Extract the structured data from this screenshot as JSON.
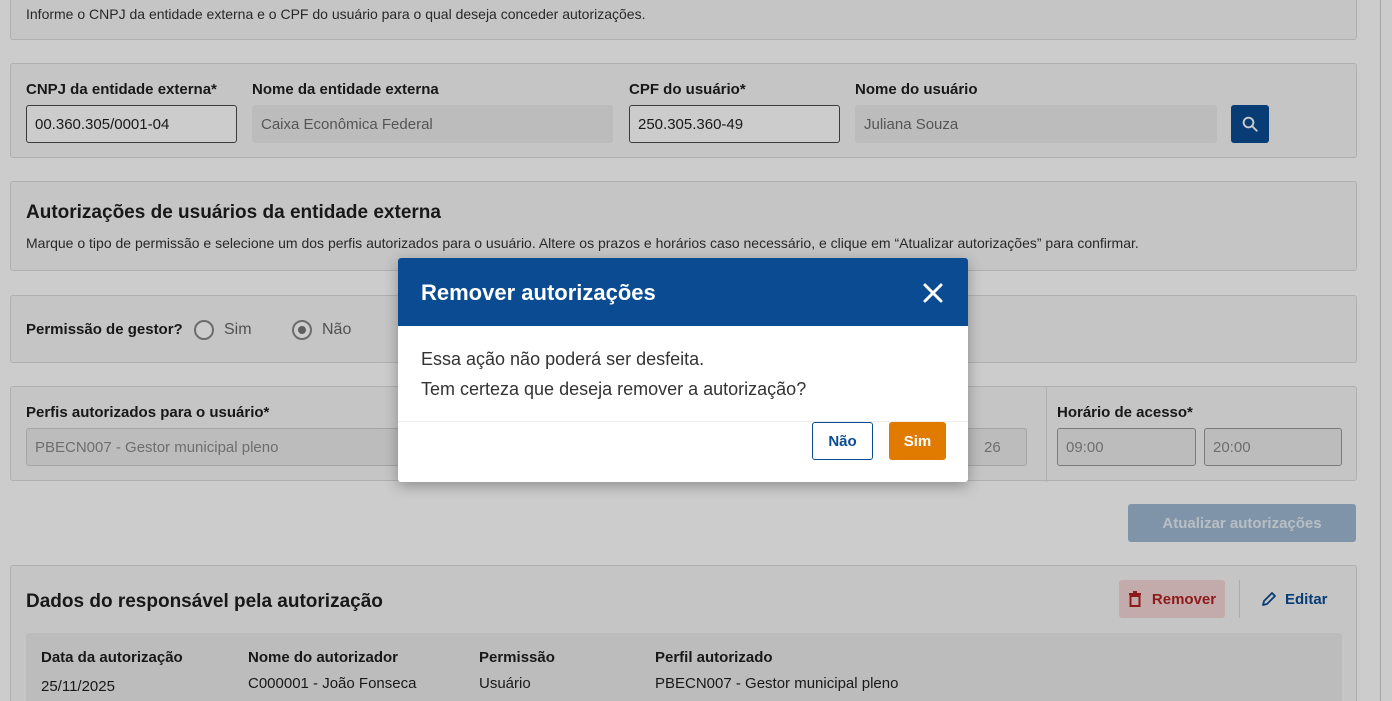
{
  "intro": {
    "text": "Informe o CNPJ da entidade externa e o CPF do usuário para o qual deseja conceder autorizações."
  },
  "search": {
    "cnpj_label": "CNPJ da entidade externa*",
    "cnpj_value": "00.360.305/0001-04",
    "entity_name_label": "Nome da entidade externa",
    "entity_name_value": "Caixa Econômica Federal",
    "cpf_label": "CPF do usuário*",
    "cpf_value": "250.305.360-49",
    "user_name_label": "Nome do usuário",
    "user_name_value": "Juliana Souza",
    "search_icon": "search-icon"
  },
  "authorizations": {
    "title": "Autorizações de usuários da entidade externa",
    "description": "Marque o tipo de permissão e selecione um dos perfis autorizados para o usuário. Altere os prazos e horários caso necessário, e clique em “Atualizar autorizações” para confirmar."
  },
  "permission": {
    "label": "Permissão de gestor?",
    "option_yes": "Sim",
    "option_no": "Não",
    "selected": "Não"
  },
  "profile": {
    "label": "Perfis autorizados para o usuário*",
    "value": "PBECN007 - Gestor municipal pleno",
    "date_partial": "26",
    "access_hours_label": "Horário de acesso*",
    "access_start": "09:00",
    "access_end": "20:00"
  },
  "update_button": "Atualizar autorizações",
  "responsible": {
    "title": "Dados do responsável pela autorização",
    "remove_label": "Remover",
    "edit_label": "Editar",
    "columns": [
      {
        "header": "Data da autorização",
        "value": "25/11/2025"
      },
      {
        "header": "Nome do autorizador",
        "value": "C000001 - João Fonseca"
      },
      {
        "header": "Permissão",
        "value": "Usuário"
      },
      {
        "header": "Perfil autorizado",
        "value": "PBECN007 - Gestor municipal pleno"
      }
    ]
  },
  "modal": {
    "title": "Remover autorizações",
    "line1": "Essa ação não poderá ser desfeita.",
    "line2": "Tem certeza que deseja remover a autorização?",
    "no_label": "Não",
    "yes_label": "Sim"
  },
  "colors": {
    "primary": "#0a4b91",
    "accent": "#e07b00",
    "danger": "#b22222"
  }
}
